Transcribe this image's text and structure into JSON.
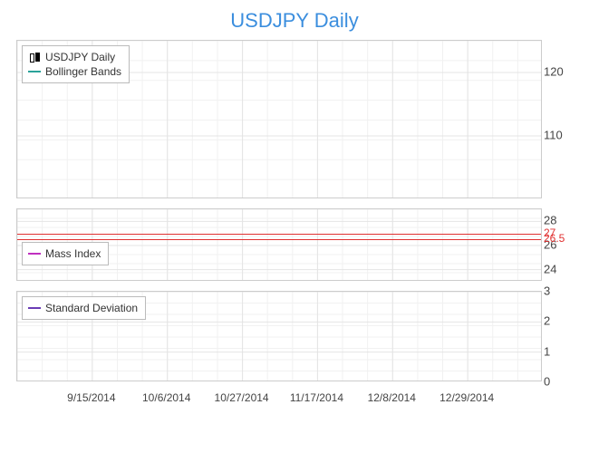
{
  "title": "USDJPY Daily",
  "x_ticks": [
    "9/15/2014",
    "10/6/2014",
    "10/27/2014",
    "11/17/2014",
    "12/8/2014",
    "12/29/2014"
  ],
  "panels": {
    "main": {
      "legend": [
        {
          "icon": "candle",
          "label": "USDJPY Daily"
        },
        {
          "icon": "line",
          "color": "#2aa39a",
          "label": "Bollinger Bands"
        }
      ],
      "y_ticks": [
        120,
        110
      ],
      "ylim": [
        100,
        125
      ]
    },
    "mass": {
      "legend": [
        {
          "icon": "line",
          "color": "#c030c0",
          "label": "Mass Index"
        }
      ],
      "y_ticks": [
        28,
        26,
        24
      ],
      "ylim": [
        23,
        29
      ],
      "ref_lines": [
        {
          "value": 27,
          "label": "27"
        },
        {
          "value": 26.5,
          "label": "26.5"
        }
      ]
    },
    "std": {
      "legend": [
        {
          "icon": "line",
          "color": "#6a3db5",
          "label": "Standard Deviation"
        }
      ],
      "y_ticks": [
        3,
        2,
        1,
        0
      ],
      "ylim": [
        0,
        3
      ]
    }
  },
  "chart_data": [
    {
      "type": "line",
      "title": "USDJPY Daily",
      "series": [
        {
          "name": "USDJPY Daily",
          "values": []
        },
        {
          "name": "Bollinger Bands",
          "values": []
        }
      ],
      "x": [
        "9/15/2014",
        "10/6/2014",
        "10/27/2014",
        "11/17/2014",
        "12/8/2014",
        "12/29/2014"
      ],
      "ylabel": "",
      "ylim": [
        100,
        125
      ],
      "grid": true
    },
    {
      "type": "line",
      "title": "Mass Index",
      "series": [
        {
          "name": "Mass Index",
          "values": []
        }
      ],
      "x": [
        "9/15/2014",
        "10/6/2014",
        "10/27/2014",
        "11/17/2014",
        "12/8/2014",
        "12/29/2014"
      ],
      "ylabel": "",
      "ylim": [
        23,
        29
      ],
      "annotations": [
        {
          "y": 27,
          "text": "27"
        },
        {
          "y": 26.5,
          "text": "26.5"
        }
      ],
      "grid": true
    },
    {
      "type": "line",
      "title": "Standard Deviation",
      "series": [
        {
          "name": "Standard Deviation",
          "values": []
        }
      ],
      "x": [
        "9/15/2014",
        "10/6/2014",
        "10/27/2014",
        "11/17/2014",
        "12/8/2014",
        "12/29/2014"
      ],
      "ylabel": "",
      "ylim": [
        0,
        3
      ],
      "grid": true
    }
  ]
}
